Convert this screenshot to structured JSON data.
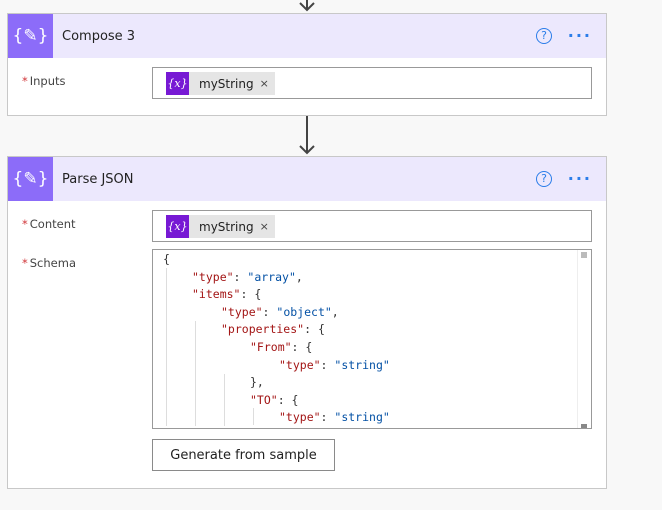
{
  "compose": {
    "title": "Compose 3",
    "icon": "compose-braces-icon",
    "inputs_label": "Inputs",
    "token": "myString"
  },
  "parse": {
    "title": "Parse JSON",
    "icon": "compose-braces-icon",
    "content_label": "Content",
    "schema_label": "Schema",
    "token": "myString",
    "generate_label": "Generate from sample",
    "schema_lines": [
      {
        "indent": 0,
        "parts": [
          [
            "{",
            "p"
          ]
        ]
      },
      {
        "indent": 1,
        "parts": [
          [
            "\"type\"",
            "k"
          ],
          [
            ": ",
            "p"
          ],
          [
            "\"array\"",
            "s"
          ],
          [
            ",",
            "p"
          ]
        ]
      },
      {
        "indent": 1,
        "parts": [
          [
            "\"items\"",
            "k"
          ],
          [
            ": {",
            "p"
          ]
        ]
      },
      {
        "indent": 2,
        "parts": [
          [
            "\"type\"",
            "k"
          ],
          [
            ": ",
            "p"
          ],
          [
            "\"object\"",
            "s"
          ],
          [
            ",",
            "p"
          ]
        ]
      },
      {
        "indent": 2,
        "parts": [
          [
            "\"properties\"",
            "k"
          ],
          [
            ": {",
            "p"
          ]
        ]
      },
      {
        "indent": 3,
        "parts": [
          [
            "\"From\"",
            "k"
          ],
          [
            ": {",
            "p"
          ]
        ]
      },
      {
        "indent": 4,
        "parts": [
          [
            "\"type\"",
            "k"
          ],
          [
            ": ",
            "p"
          ],
          [
            "\"string\"",
            "s"
          ]
        ]
      },
      {
        "indent": 3,
        "parts": [
          [
            "},",
            "p"
          ]
        ]
      },
      {
        "indent": 3,
        "parts": [
          [
            "\"TO\"",
            "k"
          ],
          [
            ": {",
            "p"
          ]
        ]
      },
      {
        "indent": 4,
        "parts": [
          [
            "\"type\"",
            "k"
          ],
          [
            ": ",
            "p"
          ],
          [
            "\"string\"",
            "s"
          ]
        ]
      }
    ]
  },
  "required_marker": "*",
  "token_icon_text": "{x}",
  "remove_glyph": "×",
  "help_glyph": "?",
  "more_glyph": "···",
  "header_icon_text": "{✎}",
  "colors": {
    "header_bg": "#ece8fd",
    "icon_bg": "#8c6cf9",
    "token_icon_bg": "#7719d4",
    "accent": "#2b7de9"
  }
}
